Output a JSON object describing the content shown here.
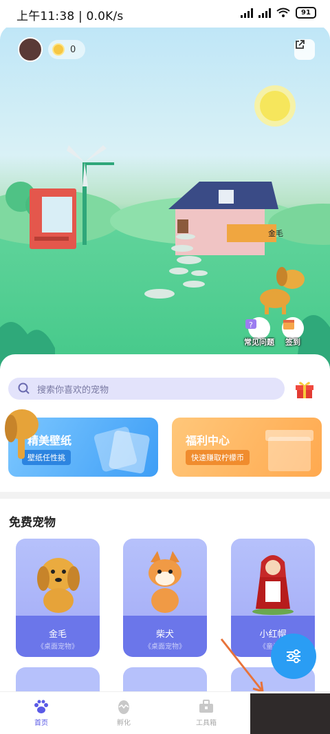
{
  "status_bar": {
    "time_text": "上午11:38 | 0.0K/s",
    "battery": "91"
  },
  "scene": {
    "coin_count": "0",
    "pet_name": "金毛",
    "faq_label": "常见问题",
    "checkin_label": "签到"
  },
  "search": {
    "placeholder": "搜索你喜欢的宠物"
  },
  "promo_cards": [
    {
      "title": "精美壁纸",
      "subtitle": "壁纸任性挑"
    },
    {
      "title": "福利中心",
      "subtitle": "快速赚取柠檬币"
    }
  ],
  "section": {
    "title": "免费宠物"
  },
  "pets": [
    {
      "name": "金毛",
      "tag": "《桌面宠物》"
    },
    {
      "name": "柴犬",
      "tag": "《桌面宠物》"
    },
    {
      "name": "小红帽",
      "tag": "《童话》"
    }
  ],
  "nav": [
    {
      "label": "首页"
    },
    {
      "label": "孵化"
    },
    {
      "label": "工具箱"
    }
  ],
  "colors": {
    "accent": "#5a5ae6",
    "fab": "#2a9df4"
  }
}
